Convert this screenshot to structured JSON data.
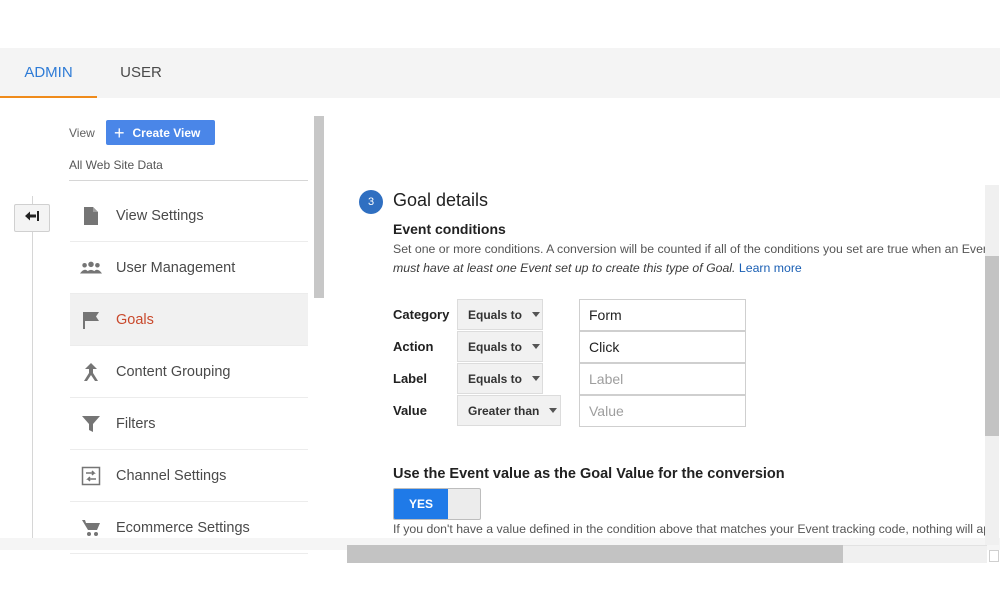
{
  "tabs": [
    {
      "label": "ADMIN",
      "active": true
    },
    {
      "label": "USER",
      "active": false
    }
  ],
  "colors": {
    "accent_blue": "#2e7bd6",
    "tab_underline": "#ef8b1b",
    "active_nav": "#c9492c",
    "create_button": "#4a86e8",
    "toggle_on": "#1f7ae8",
    "step_badge": "#2f6fc1"
  },
  "sidebar": {
    "view_label": "View",
    "create_view_label": "Create View",
    "view_name": "All Web Site Data",
    "items": [
      {
        "label": "View Settings",
        "icon": "document-icon",
        "active": false
      },
      {
        "label": "User Management",
        "icon": "people-icon",
        "active": false
      },
      {
        "label": "Goals",
        "icon": "flag-icon",
        "active": true
      },
      {
        "label": "Content Grouping",
        "icon": "merge-arrow-icon",
        "active": false
      },
      {
        "label": "Filters",
        "icon": "filter-icon",
        "active": false
      },
      {
        "label": "Channel Settings",
        "icon": "channel-settings-icon",
        "active": false
      },
      {
        "label": "Ecommerce Settings",
        "icon": "cart-icon",
        "active": false
      }
    ]
  },
  "goal": {
    "step_number": "3",
    "title": "Goal details",
    "event_conditions_title": "Event conditions",
    "desc_part1": "Set one or more conditions. A conversion will be counted if all of the conditions you set are true when an Event",
    "desc_italic": "must have at least one Event set up to create this type of Goal.",
    "learn_more": "Learn more",
    "conditions": [
      {
        "label": "Category",
        "operator": "Equals to",
        "value": "Form",
        "placeholder": ""
      },
      {
        "label": "Action",
        "operator": "Equals to",
        "value": "Click",
        "placeholder": ""
      },
      {
        "label": "Label",
        "operator": "Equals to",
        "value": "",
        "placeholder": "Label"
      },
      {
        "label": "Value",
        "operator": "Greater than",
        "value": "",
        "placeholder": "Value"
      }
    ],
    "use_event_value_title": "Use the Event value as the Goal Value for the conversion",
    "toggle_label": "YES",
    "note": "If you don't have a value defined in the condition above that matches your Event tracking code, nothing will app"
  }
}
